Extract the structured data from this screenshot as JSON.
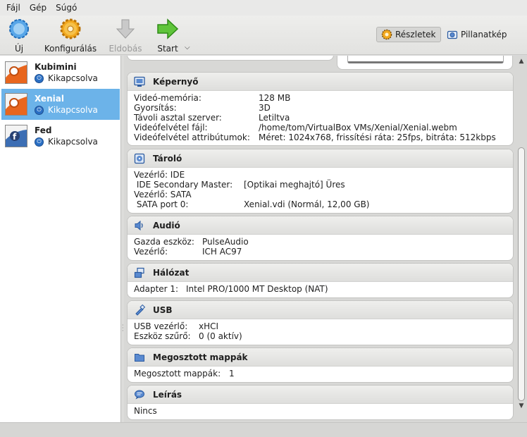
{
  "menu": [
    {
      "label": "Fájl"
    },
    {
      "label": "Gép"
    },
    {
      "label": "Súgó"
    }
  ],
  "toolbar": {
    "new_label": "Új",
    "configure_label": "Konfigurálás",
    "discard_label": "Eldobás",
    "start_label": "Start",
    "details_label": "Részletek",
    "snapshots_label": "Pillanatkép"
  },
  "vms": [
    {
      "name": "Kubimini",
      "state": "Kikapcsolva",
      "selected": false
    },
    {
      "name": "Xenial",
      "state": "Kikapcsolva",
      "selected": true
    },
    {
      "name": "Fed",
      "state": "Kikapcsolva",
      "selected": false
    }
  ],
  "sections": {
    "display": {
      "title": "Képernyő",
      "rows": [
        {
          "k": "Videó-memória:",
          "v": "128 MB"
        },
        {
          "k": "Gyorsítás:",
          "v": "3D"
        },
        {
          "k": "Távoli asztal szerver:",
          "v": "Letiltva"
        },
        {
          "k": "Videófelvétel fájl:",
          "v": "/home/tom/VirtualBox VMs/Xenial/Xenial.webm"
        },
        {
          "k": "Videófelvétel attribútumok:",
          "v": "Méret: 1024x768, frissítési ráta: 25fps, bitráta: 512kbps"
        }
      ]
    },
    "storage": {
      "title": "Tároló",
      "rows": [
        {
          "k": "Vezérlő: IDE",
          "v": ""
        },
        {
          "k": " IDE Secondary Master:",
          "v": "[Optikai meghajtó] Üres"
        },
        {
          "k": "Vezérlő: SATA",
          "v": ""
        },
        {
          "k": " SATA port 0:",
          "v": "Xenial.vdi (Normál, 12,00 GB)"
        }
      ]
    },
    "audio": {
      "title": "Audió",
      "rows": [
        {
          "k": "Gazda eszköz:",
          "v": "PulseAudio"
        },
        {
          "k": "Vezérlő:",
          "v": "ICH AC97"
        }
      ]
    },
    "network": {
      "title": "Hálózat",
      "rows": [
        {
          "k": "Adapter 1:",
          "v": "Intel PRO/1000 MT Desktop (NAT)"
        }
      ]
    },
    "usb": {
      "title": "USB",
      "rows": [
        {
          "k": "USB vezérlő:",
          "v": "xHCI"
        },
        {
          "k": "Eszköz szűrő:",
          "v": "0 (0 aktív)"
        }
      ]
    },
    "shared": {
      "title": "Megosztott mappák",
      "rows": [
        {
          "k": "Megosztott mappák:",
          "v": "1"
        }
      ]
    },
    "description": {
      "title": "Leírás",
      "rows": [
        {
          "k": "Nincs",
          "v": ""
        }
      ]
    }
  },
  "colors": {
    "selection": "#6cb3e9",
    "accent_blue": "#2a6fc4"
  },
  "icons": {
    "new": "new-vm-icon",
    "configure": "gear-icon",
    "discard": "discard-arrow-icon",
    "start": "start-arrow-icon"
  }
}
